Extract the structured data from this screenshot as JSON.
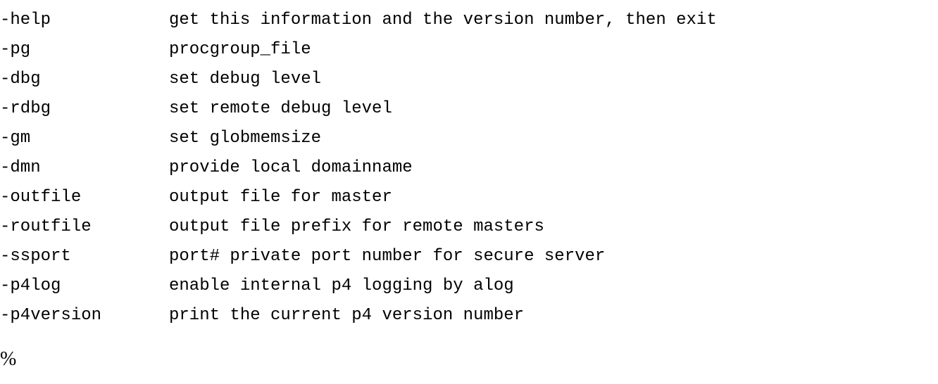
{
  "options": [
    {
      "flag": "-help",
      "desc": "get this information and the version number, then exit"
    },
    {
      "flag": "-pg",
      "desc": "procgroup_file"
    },
    {
      "flag": "-dbg",
      "desc": "set debug level"
    },
    {
      "flag": "-rdbg",
      "desc": "set remote debug level"
    },
    {
      "flag": "-gm",
      "desc": "set globmemsize"
    },
    {
      "flag": "-dmn",
      "desc": "provide local domainname"
    },
    {
      "flag": "-outfile",
      "desc": "output file for master"
    },
    {
      "flag": "-routfile",
      "desc": "output file prefix for remote masters"
    },
    {
      "flag": "-ssport",
      "desc": "port# private port number for secure server"
    },
    {
      "flag": "-p4log",
      "desc": "enable internal p4 logging by alog"
    },
    {
      "flag": "-p4version",
      "desc": "print the current p4 version number"
    }
  ],
  "prompt": "%"
}
